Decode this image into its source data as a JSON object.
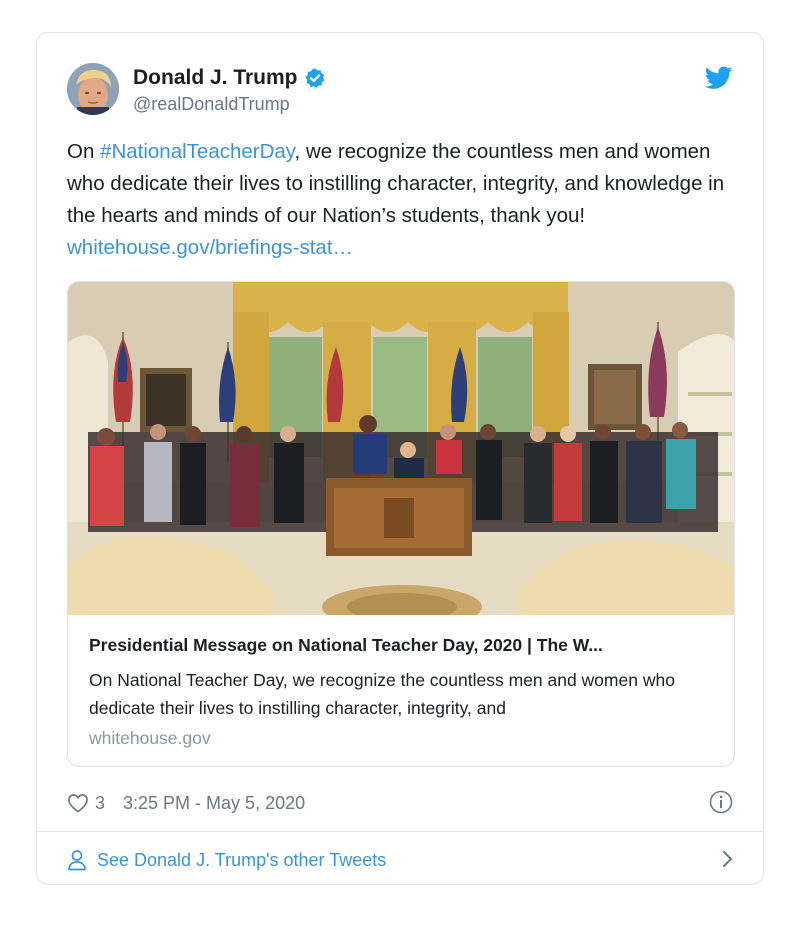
{
  "tweet": {
    "author": {
      "name": "Donald J. Trump",
      "handle": "@realDonaldTrump",
      "verified": true
    },
    "text": {
      "prefix": "On ",
      "hashtag": "#NationalTeacherDay",
      "body": ", we recognize the countless men and women who dedicate their lives to instilling character, integrity, and knowledge in the hearts and minds of our Nation’s students, thank you! ",
      "link": "whitehouse.gov/briefings-stat…"
    },
    "link_card": {
      "title": "Presidential Message on National Teacher Day, 2020 | The W...",
      "description": "On National Teacher Day, we recognize the countless men and women who dedicate their lives to instilling character, integrity, and",
      "domain": "whitehouse.gov"
    },
    "meta": {
      "likes": "3",
      "timestamp": "3:25 PM - May 5, 2020"
    },
    "footer": {
      "label": "See Donald J. Trump's other Tweets"
    }
  },
  "icons": {
    "brand": "twitter-bird-icon",
    "verified": "verified-badge-icon",
    "like": "heart-icon",
    "info": "info-icon",
    "profile": "person-icon",
    "more": "chevron-right-icon"
  },
  "colors": {
    "link": "#3b94d9",
    "brand": "#1da1f2",
    "muted": "#697882",
    "border": "#dfe3e7"
  }
}
